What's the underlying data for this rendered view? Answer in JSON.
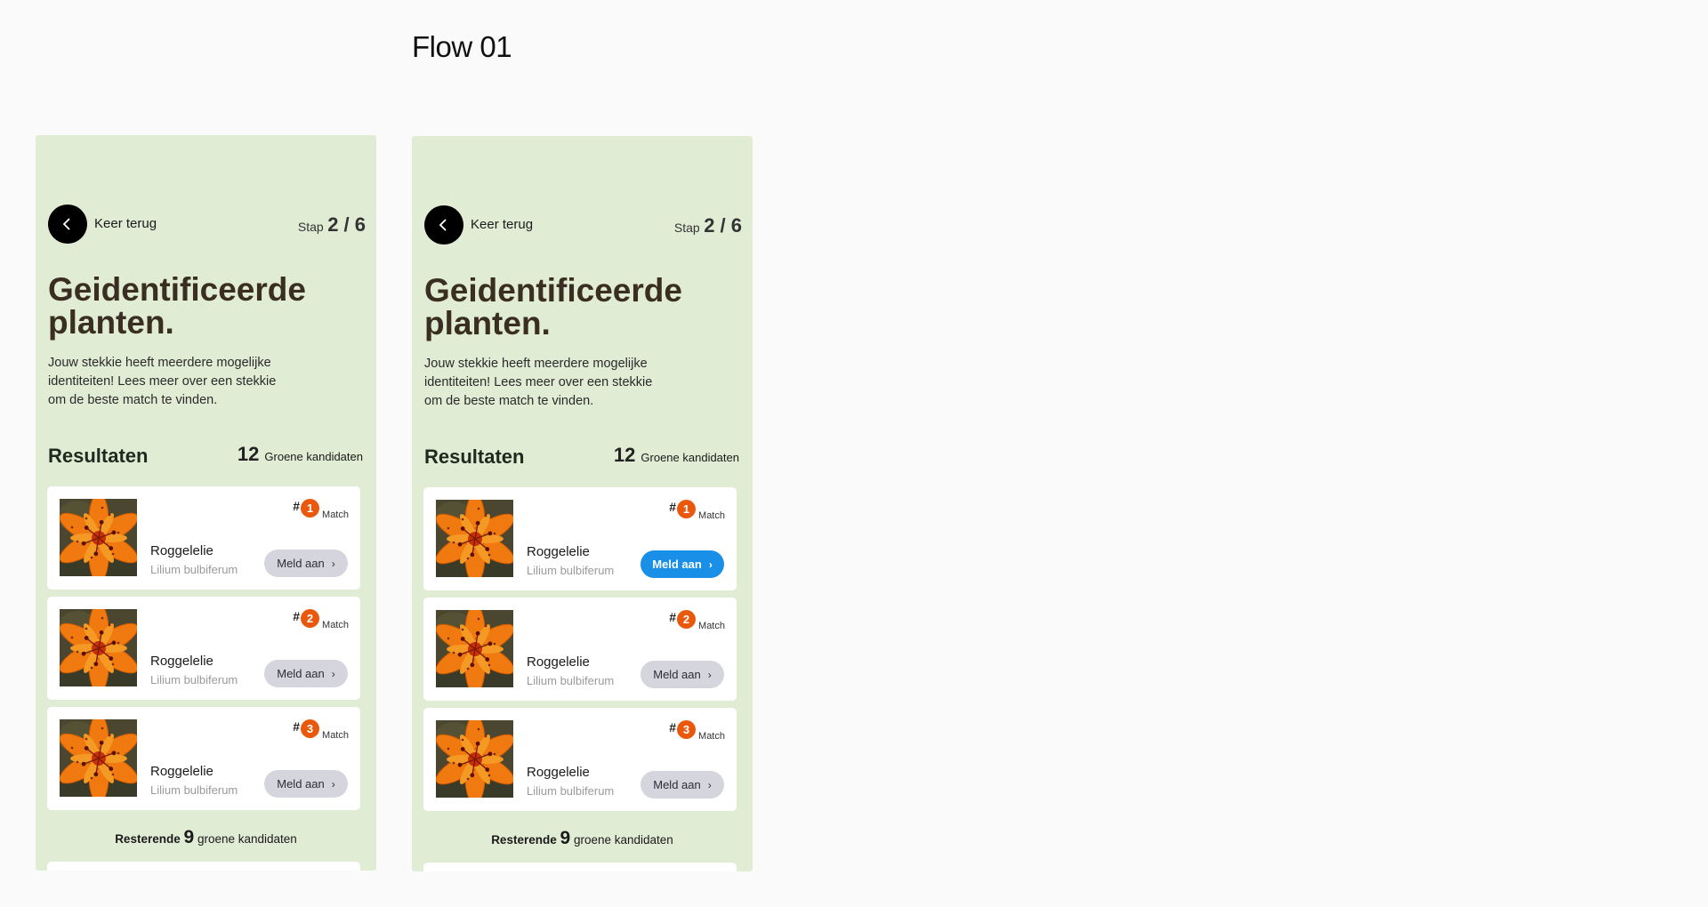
{
  "canvas": {
    "title": "Flow 01"
  },
  "screens": [
    {
      "back_label": "Keer terug",
      "step_prefix": "Stap",
      "step_value": "2 / 6",
      "headline": "Geidentificeerde planten.",
      "intro": "Jouw stekkie heeft meerdere mogelijke identiteiten! Lees meer over een stekkie om de beste match te vinden.",
      "results_title": "Resultaten",
      "results_count": "12",
      "results_count_label": "Groene kandidaten",
      "cards": [
        {
          "rank": "1",
          "hash": "#",
          "match_label": "Match",
          "name": "Roggelelie",
          "latin": "Lilium bulbiferum",
          "button": "Meld aan",
          "button_state": "default"
        },
        {
          "rank": "2",
          "hash": "#",
          "match_label": "Match",
          "name": "Roggelelie",
          "latin": "Lilium bulbiferum",
          "button": "Meld aan",
          "button_state": "default"
        },
        {
          "rank": "3",
          "hash": "#",
          "match_label": "Match",
          "name": "Roggelelie",
          "latin": "Lilium bulbiferum",
          "button": "Meld aan",
          "button_state": "default"
        }
      ],
      "remaining_prefix": "Resterende",
      "remaining_count": "9",
      "remaining_suffix": "groene kandidaten"
    },
    {
      "back_label": "Keer terug",
      "step_prefix": "Stap",
      "step_value": "2 / 6",
      "headline": "Geidentificeerde planten.",
      "intro": "Jouw stekkie heeft meerdere mogelijke identiteiten! Lees meer over een stekkie om de beste match te vinden.",
      "results_title": "Resultaten",
      "results_count": "12",
      "results_count_label": "Groene kandidaten",
      "cards": [
        {
          "rank": "1",
          "hash": "#",
          "match_label": "Match",
          "name": "Roggelelie",
          "latin": "Lilium bulbiferum",
          "button": "Meld aan",
          "button_state": "active"
        },
        {
          "rank": "2",
          "hash": "#",
          "match_label": "Match",
          "name": "Roggelelie",
          "latin": "Lilium bulbiferum",
          "button": "Meld aan",
          "button_state": "default"
        },
        {
          "rank": "3",
          "hash": "#",
          "match_label": "Match",
          "name": "Roggelelie",
          "latin": "Lilium bulbiferum",
          "button": "Meld aan",
          "button_state": "default"
        }
      ],
      "remaining_prefix": "Resterende",
      "remaining_count": "9",
      "remaining_suffix": "groene kandidaten"
    }
  ],
  "colors": {
    "screen_bg": "#e1ecd5",
    "rank_badge": "#e9580c",
    "button_default": "#d4d5dd",
    "button_active": "#1a8fe8",
    "headline": "#3a2e22"
  },
  "icons": {
    "back": "chevron-left-icon",
    "button_chevron": "chevron-right-icon",
    "thumbnail": "lily-flower-photo"
  }
}
